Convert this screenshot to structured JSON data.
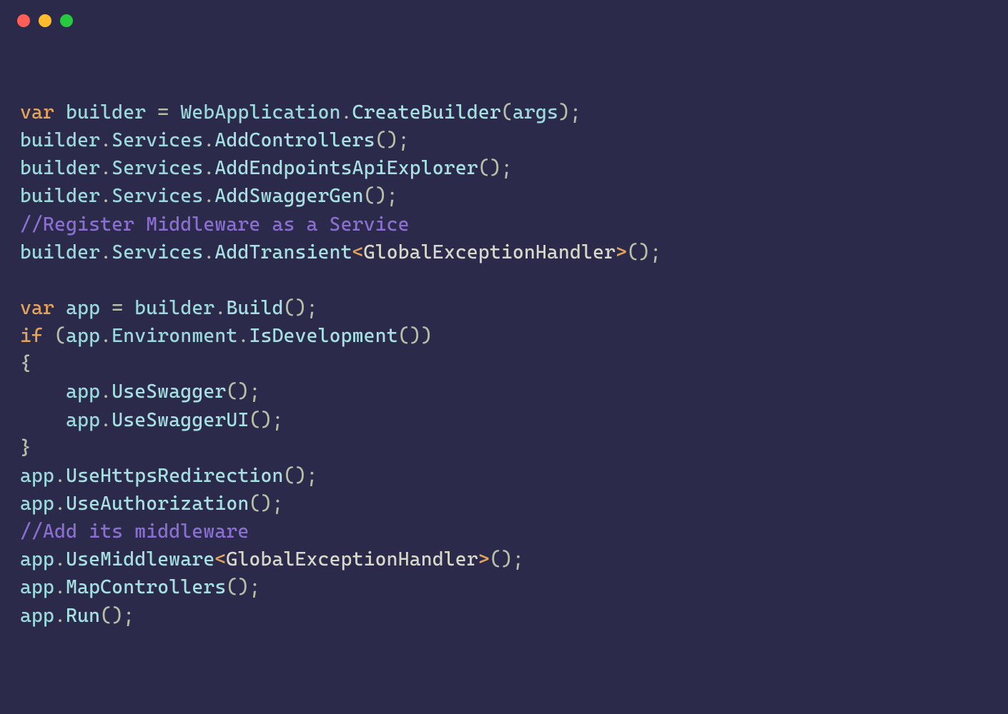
{
  "colors": {
    "background": "#2b2a4a",
    "keyword": "#e5a35a",
    "identifier": "#9dd9dc",
    "method": "#a7e0e2",
    "type": "#d7d8c9",
    "comment": "#8a6fd1",
    "punct": "#b8bfa8",
    "trafficRed": "#ff5f56",
    "trafficYellow": "#ffbd2e",
    "trafficGreen": "#27c93f"
  },
  "code": {
    "line1": {
      "kw_var": "var",
      "sp1": " ",
      "builder": "builder",
      "sp2": " ",
      "eq": "=",
      "sp3": " ",
      "webapp": "WebApplication",
      "dot1": ".",
      "create": "CreateBuilder",
      "op": "(",
      "args": "args",
      "cp": ")",
      "semi": ";"
    },
    "line2": {
      "builder": "builder",
      "dot1": ".",
      "services": "Services",
      "dot2": ".",
      "method": "AddControllers",
      "op": "(",
      "cp": ")",
      "semi": ";"
    },
    "line3": {
      "builder": "builder",
      "dot1": ".",
      "services": "Services",
      "dot2": ".",
      "method": "AddEndpointsApiExplorer",
      "op": "(",
      "cp": ")",
      "semi": ";"
    },
    "line4": {
      "builder": "builder",
      "dot1": ".",
      "services": "Services",
      "dot2": ".",
      "method": "AddSwaggerGen",
      "op": "(",
      "cp": ")",
      "semi": ";"
    },
    "line5": {
      "comment": "//Register Middleware as a Service"
    },
    "line6": {
      "builder": "builder",
      "dot1": ".",
      "services": "Services",
      "dot2": ".",
      "method": "AddTransient",
      "lt": "<",
      "type": "GlobalExceptionHandler",
      "gt": ">",
      "op": "(",
      "cp": ")",
      "semi": ";"
    },
    "line7_blank": "",
    "line8": {
      "kw_var": "var",
      "sp1": " ",
      "app": "app",
      "sp2": " ",
      "eq": "=",
      "sp3": " ",
      "builder": "builder",
      "dot1": ".",
      "method": "Build",
      "op": "(",
      "cp": ")",
      "semi": ";"
    },
    "line9": {
      "kw_if": "if",
      "sp1": " ",
      "op1": "(",
      "app": "app",
      "dot1": ".",
      "env": "Environment",
      "dot2": ".",
      "method": "IsDevelopment",
      "op2": "(",
      "cp2": ")",
      "cp1": ")"
    },
    "line10": {
      "brace": "{"
    },
    "line11": {
      "indent": "    ",
      "app": "app",
      "dot1": ".",
      "method": "UseSwagger",
      "op": "(",
      "cp": ")",
      "semi": ";"
    },
    "line12": {
      "indent": "    ",
      "app": "app",
      "dot1": ".",
      "method": "UseSwaggerUI",
      "op": "(",
      "cp": ")",
      "semi": ";"
    },
    "line13": {
      "brace": "}"
    },
    "line14": {
      "app": "app",
      "dot1": ".",
      "method": "UseHttpsRedirection",
      "op": "(",
      "cp": ")",
      "semi": ";"
    },
    "line15": {
      "app": "app",
      "dot1": ".",
      "method": "UseAuthorization",
      "op": "(",
      "cp": ")",
      "semi": ";"
    },
    "line16": {
      "comment": "//Add its middleware"
    },
    "line17": {
      "app": "app",
      "dot1": ".",
      "method": "UseMiddleware",
      "lt": "<",
      "type": "GlobalExceptionHandler",
      "gt": ">",
      "op": "(",
      "cp": ")",
      "semi": ";"
    },
    "line18": {
      "app": "app",
      "dot1": ".",
      "method": "MapControllers",
      "op": "(",
      "cp": ")",
      "semi": ";"
    },
    "line19": {
      "app": "app",
      "dot1": ".",
      "method": "Run",
      "op": "(",
      "cp": ")",
      "semi": ";"
    }
  }
}
